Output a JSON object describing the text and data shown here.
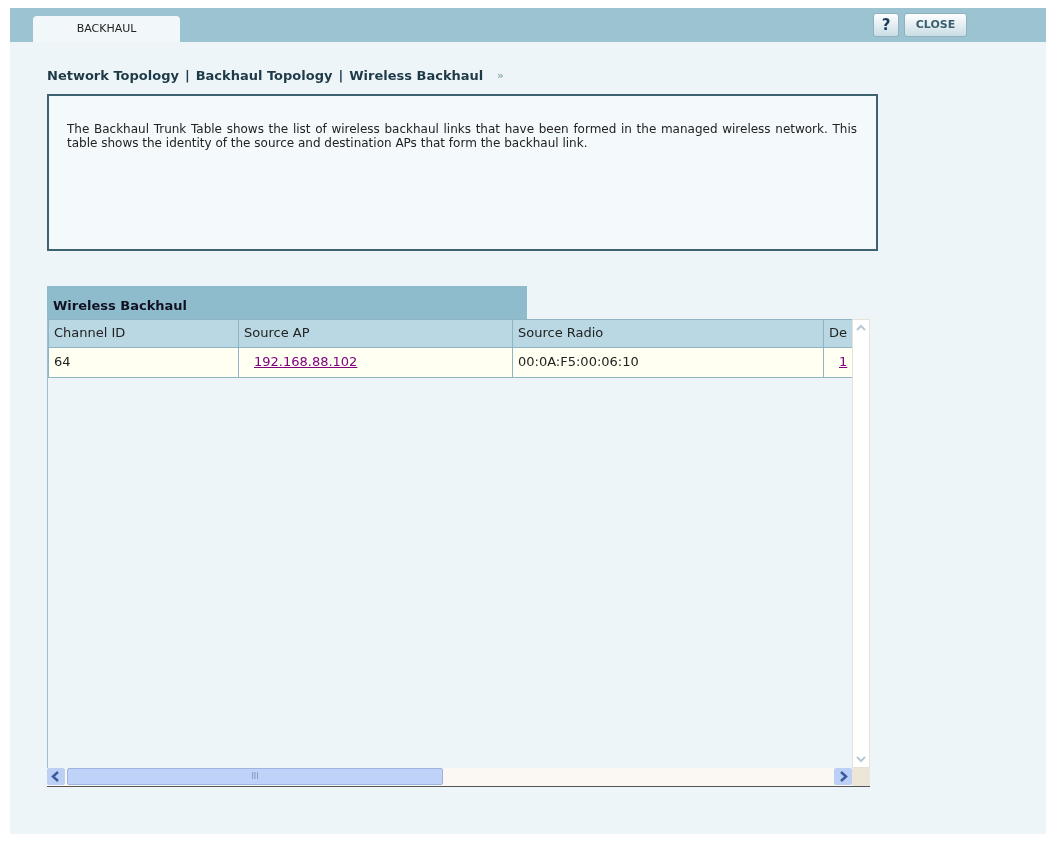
{
  "tabs": [
    {
      "label": "BACKHAUL",
      "selected": true
    }
  ],
  "toolbar_buttons": [
    {
      "label": "?",
      "kind": "help"
    },
    {
      "label": "CLOSE",
      "kind": "text"
    }
  ],
  "breadcrumb": {
    "items": [
      "Network Topology",
      "Backhaul Topology",
      "Wireless Backhaul"
    ],
    "separator": "|",
    "more": "»"
  },
  "description": "The Backhaul Trunk Table shows the list of wireless backhaul links that have been formed in the managed wireless network. This table shows the identity of the source and destination APs that form the backhaul link.",
  "table": {
    "title": "Wireless Backhaul",
    "columns": [
      "Channel ID",
      "Source AP",
      "Source Radio",
      "De"
    ],
    "rows": [
      [
        {
          "text": "64",
          "kind": "text"
        },
        {
          "text": "192.168.88.102",
          "kind": "link"
        },
        {
          "text": "00:0A:F5:00:06:10",
          "kind": "text"
        },
        {
          "text": "1",
          "kind": "link"
        }
      ]
    ],
    "scrollbar_thumb_label": "III"
  }
}
